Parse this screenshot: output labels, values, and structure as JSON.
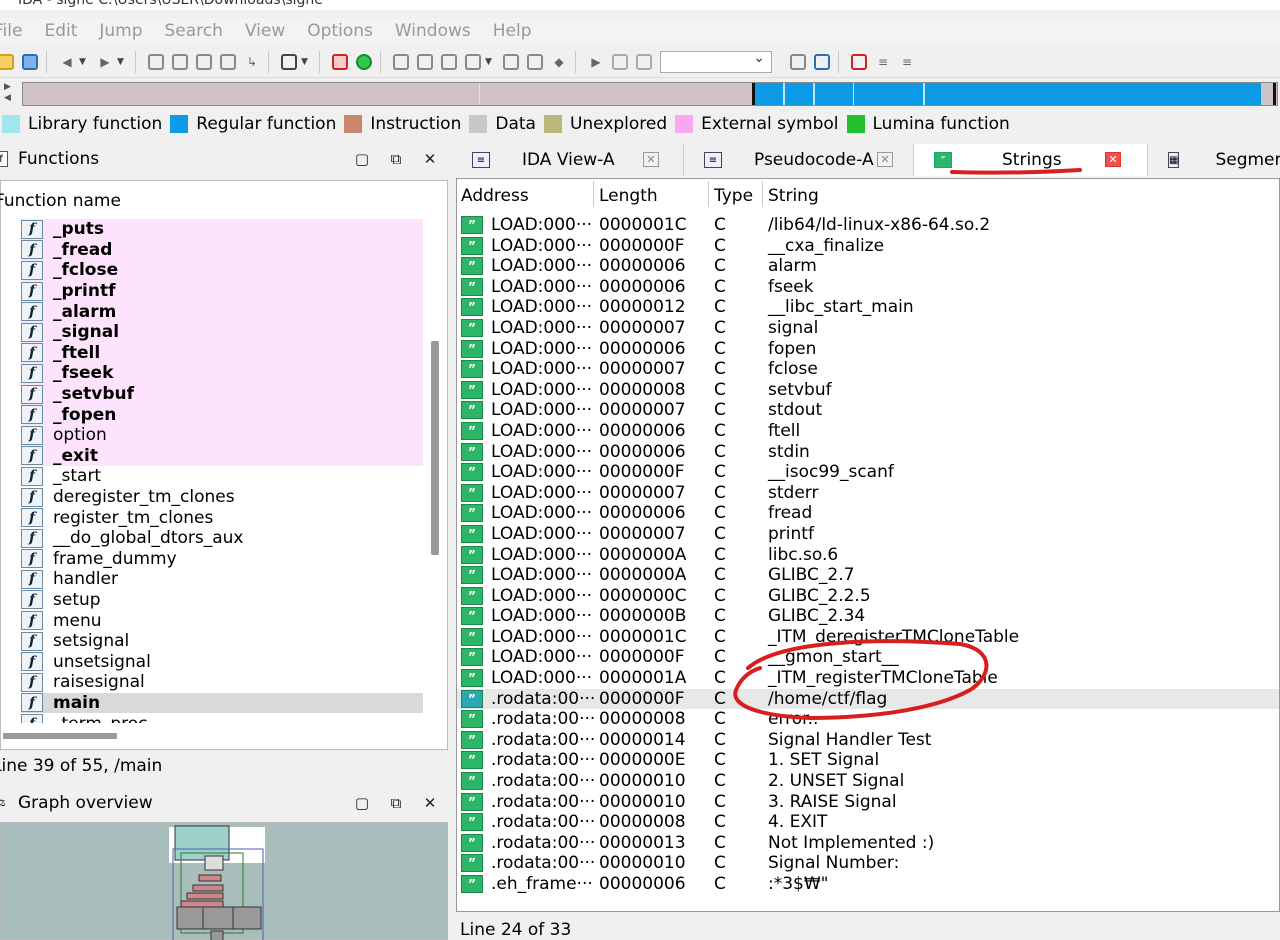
{
  "window": {
    "title": "IDA - signe C:\\Users\\USER\\Downloads\\signe"
  },
  "menu": [
    "File",
    "Edit",
    "Jump",
    "Search",
    "View",
    "Options",
    "Windows",
    "Help"
  ],
  "legend": [
    {
      "label": "Library function",
      "color": "#9fe6ef"
    },
    {
      "label": "Regular function",
      "color": "#0e9be6"
    },
    {
      "label": "Instruction",
      "color": "#c8866c"
    },
    {
      "label": "Data",
      "color": "#c8c8c8"
    },
    {
      "label": "Unexplored",
      "color": "#bcb77a"
    },
    {
      "label": "External symbol",
      "color": "#f7a8f0"
    },
    {
      "label": "Lumina function",
      "color": "#22c12e"
    }
  ],
  "functions_panel": {
    "title": "Functions",
    "column": "Function name",
    "items": [
      {
        "name": "_puts",
        "lib": true,
        "bold": true
      },
      {
        "name": "_fread",
        "lib": true,
        "bold": true
      },
      {
        "name": "_fclose",
        "lib": true,
        "bold": true
      },
      {
        "name": "_printf",
        "lib": true,
        "bold": true
      },
      {
        "name": "_alarm",
        "lib": true,
        "bold": true
      },
      {
        "name": "_signal",
        "lib": true,
        "bold": true
      },
      {
        "name": "_ftell",
        "lib": true,
        "bold": true
      },
      {
        "name": "_fseek",
        "lib": true,
        "bold": true
      },
      {
        "name": "_setvbuf",
        "lib": true,
        "bold": true
      },
      {
        "name": "_fopen",
        "lib": true,
        "bold": true
      },
      {
        "name": "option",
        "lib": true,
        "bold": false
      },
      {
        "name": "_exit",
        "lib": true,
        "bold": true
      },
      {
        "name": "_start",
        "lib": false,
        "bold": false
      },
      {
        "name": "deregister_tm_clones",
        "lib": false,
        "bold": false
      },
      {
        "name": "register_tm_clones",
        "lib": false,
        "bold": false
      },
      {
        "name": "__do_global_dtors_aux",
        "lib": false,
        "bold": false
      },
      {
        "name": "frame_dummy",
        "lib": false,
        "bold": false
      },
      {
        "name": "handler",
        "lib": false,
        "bold": false
      },
      {
        "name": "setup",
        "lib": false,
        "bold": false
      },
      {
        "name": "menu",
        "lib": false,
        "bold": false
      },
      {
        "name": "setsignal",
        "lib": false,
        "bold": false
      },
      {
        "name": "unsetsignal",
        "lib": false,
        "bold": false
      },
      {
        "name": "raisesignal",
        "lib": false,
        "bold": false
      },
      {
        "name": "main",
        "lib": false,
        "bold": true,
        "selected": true
      },
      {
        "name": "_term_proc",
        "lib": false,
        "bold": false
      }
    ],
    "status": "Line 39 of 55, /main"
  },
  "graph_panel": {
    "title": "Graph overview"
  },
  "tabs": [
    {
      "label": "IDA View-A",
      "active": false
    },
    {
      "label": "Pseudocode-A",
      "active": false
    },
    {
      "label": "Strings",
      "active": true
    },
    {
      "label": "Segmen",
      "active": false
    }
  ],
  "strings_view": {
    "columns": [
      "Address",
      "Length",
      "Type",
      "String"
    ],
    "rows": [
      [
        "LOAD:000···",
        "0000001C",
        "C",
        "/lib64/ld-linux-x86-64.so.2"
      ],
      [
        "LOAD:000···",
        "0000000F",
        "C",
        "__cxa_finalize"
      ],
      [
        "LOAD:000···",
        "00000006",
        "C",
        "alarm"
      ],
      [
        "LOAD:000···",
        "00000006",
        "C",
        "fseek"
      ],
      [
        "LOAD:000···",
        "00000012",
        "C",
        "__libc_start_main"
      ],
      [
        "LOAD:000···",
        "00000007",
        "C",
        "signal"
      ],
      [
        "LOAD:000···",
        "00000006",
        "C",
        "fopen"
      ],
      [
        "LOAD:000···",
        "00000007",
        "C",
        "fclose"
      ],
      [
        "LOAD:000···",
        "00000008",
        "C",
        "setvbuf"
      ],
      [
        "LOAD:000···",
        "00000007",
        "C",
        "stdout"
      ],
      [
        "LOAD:000···",
        "00000006",
        "C",
        "ftell"
      ],
      [
        "LOAD:000···",
        "00000006",
        "C",
        "stdin"
      ],
      [
        "LOAD:000···",
        "0000000F",
        "C",
        "__isoc99_scanf"
      ],
      [
        "LOAD:000···",
        "00000007",
        "C",
        "stderr"
      ],
      [
        "LOAD:000···",
        "00000006",
        "C",
        "fread"
      ],
      [
        "LOAD:000···",
        "00000007",
        "C",
        "printf"
      ],
      [
        "LOAD:000···",
        "0000000A",
        "C",
        "libc.so.6"
      ],
      [
        "LOAD:000···",
        "0000000A",
        "C",
        "GLIBC_2.7"
      ],
      [
        "LOAD:000···",
        "0000000C",
        "C",
        "GLIBC_2.2.5"
      ],
      [
        "LOAD:000···",
        "0000000B",
        "C",
        "GLIBC_2.34"
      ],
      [
        "LOAD:000···",
        "0000001C",
        "C",
        "_ITM_deregisterTMCloneTable"
      ],
      [
        "LOAD:000···",
        "0000000F",
        "C",
        "__gmon_start__"
      ],
      [
        "LOAD:000···",
        "0000001A",
        "C",
        "_ITM_registerTMCloneTable"
      ],
      [
        ".rodata:00···",
        "0000000F",
        "C",
        "/home/ctf/flag"
      ],
      [
        ".rodata:00···",
        "00000008",
        "C",
        "error.."
      ],
      [
        ".rodata:00···",
        "00000014",
        "C",
        "Signal Handler Test"
      ],
      [
        ".rodata:00···",
        "0000000E",
        "C",
        "1. SET Signal"
      ],
      [
        ".rodata:00···",
        "00000010",
        "C",
        "2. UNSET Signal"
      ],
      [
        ".rodata:00···",
        "00000010",
        "C",
        "3. RAISE Signal"
      ],
      [
        ".rodata:00···",
        "00000008",
        "C",
        "4. EXIT"
      ],
      [
        ".rodata:00···",
        "00000013",
        "C",
        "Not Implemented :)"
      ],
      [
        ".rodata:00···",
        "00000010",
        "C",
        "Signal Number: "
      ],
      [
        ".eh_frame···",
        "00000006",
        "C",
        ":*3$₩\""
      ]
    ],
    "selected_row": 23,
    "status": "Line 24 of 33"
  }
}
